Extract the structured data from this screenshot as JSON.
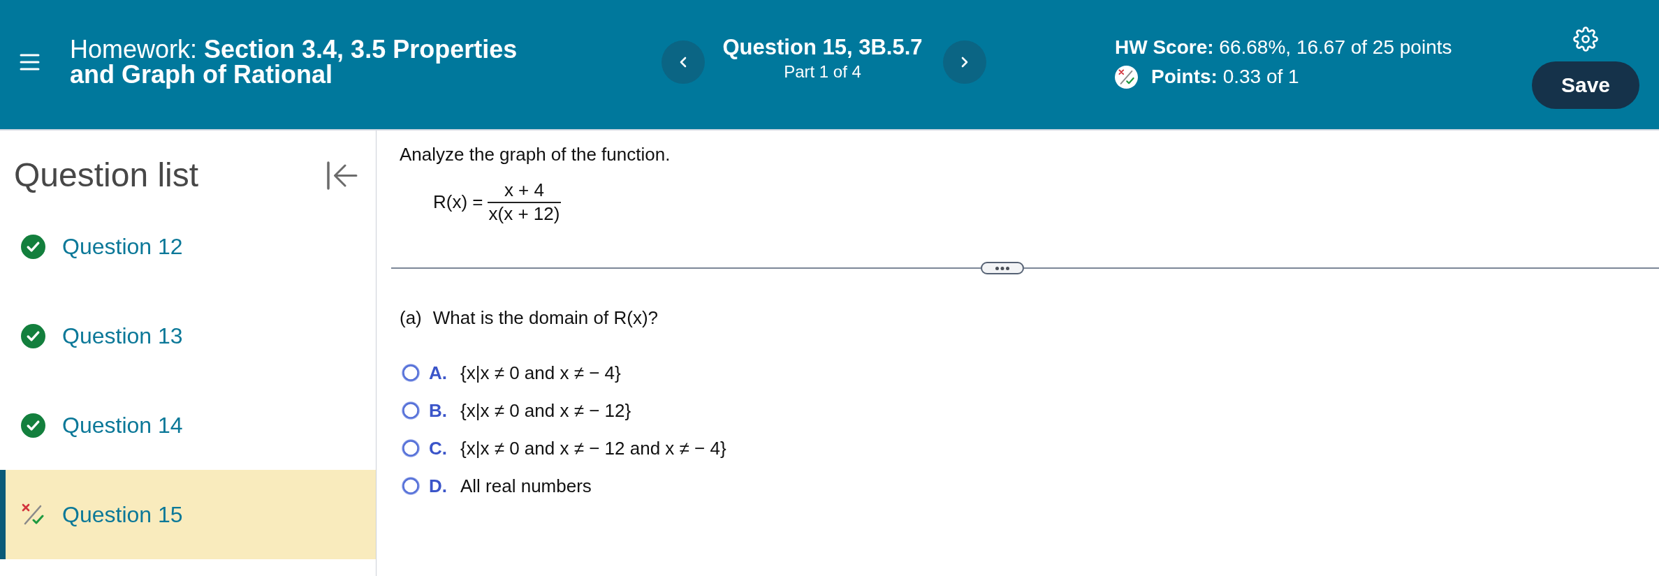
{
  "header": {
    "title": "Homework: **Section 3.4, 3.5 Properties and Graph of Rational**",
    "question": "Question 15, 3B.5.7",
    "part": "Part 1 of 4",
    "score": "**HW Score:** 66.68%, 16.67 of 25 points",
    "points": {
      "kind": "partial",
      "text": "**Points:** 0.33 of 1"
    },
    "save": "Save"
  },
  "sidebar": {
    "title": "Question list",
    "items": [
      {
        "label": "Question 12",
        "kind": "correct",
        "selected": false
      },
      {
        "label": "Question 13",
        "kind": "correct",
        "selected": false
      },
      {
        "label": "Question 14",
        "kind": "correct",
        "selected": false
      },
      {
        "label": "Question 15",
        "kind": "partial",
        "selected": true
      }
    ]
  },
  "question": {
    "prompt": "Analyze the graph of the function.",
    "formula": {
      "lhs": "R(x) =",
      "numerator": "x + 4",
      "denominator": "x(x + 12)"
    },
    "part": {
      "label": "(a)",
      "text": "What is the domain of R(x)?",
      "options": [
        {
          "letter": "A.",
          "text": "{x|x ≠ 0 and x ≠ − 4}",
          "selected": false
        },
        {
          "letter": "B.",
          "text": "{x|x ≠ 0 and x ≠ − 12}",
          "selected": false
        },
        {
          "letter": "C.",
          "text": "{x|x ≠ 0 and x ≠ − 12 and x ≠ − 4}",
          "selected": false
        },
        {
          "letter": "D.",
          "text": "All real numbers",
          "selected": false
        }
      ]
    }
  }
}
